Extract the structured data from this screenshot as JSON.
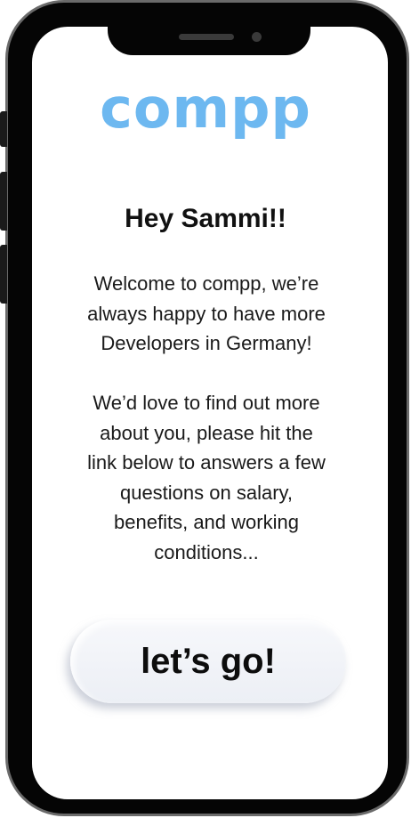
{
  "app": {
    "logo_text": "compp",
    "brand_color": "#6db8f0"
  },
  "greeting": "Hey Sammi!!",
  "welcome_lines": [
    "Welcome to compp, we’re",
    "always happy to have more",
    "Developers in Germany!"
  ],
  "survey_lines": [
    "We’d love to find out more",
    "about you, please hit the",
    "link below to answers a few",
    "questions on salary,",
    "benefits, and working",
    "conditions..."
  ],
  "cta": {
    "label": "let’s go!"
  }
}
